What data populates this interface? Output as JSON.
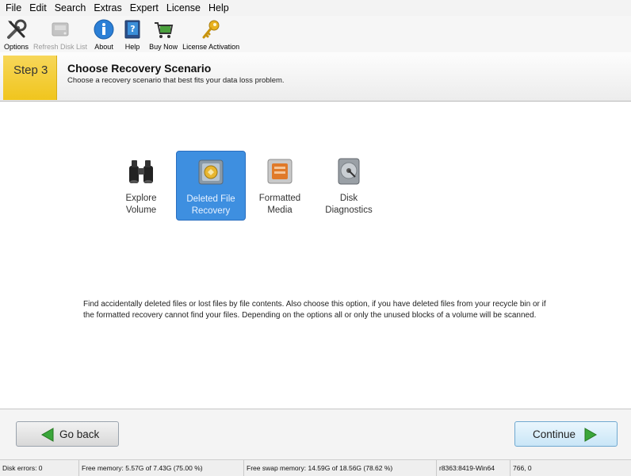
{
  "menu": [
    "File",
    "Edit",
    "Search",
    "Extras",
    "Expert",
    "License",
    "Help"
  ],
  "toolbar": {
    "options": "Options",
    "refresh": "Refresh Disk List",
    "about": "About",
    "help": "Help",
    "buy": "Buy Now",
    "license": "License Activation"
  },
  "step": {
    "badge": "Step 3",
    "title": "Choose Recovery Scenario",
    "subtitle": "Choose a recovery scenario that best fits your data loss problem."
  },
  "scenarios": [
    {
      "label": "Explore\nVolume",
      "icon": "binoculars-icon",
      "selected": false
    },
    {
      "label": "Deleted File\nRecovery",
      "icon": "recycle-bin-icon",
      "selected": true
    },
    {
      "label": "Formatted\nMedia",
      "icon": "formatted-disk-icon",
      "selected": false
    },
    {
      "label": "Disk\nDiagnostics",
      "icon": "disk-diagnostics-icon",
      "selected": false
    }
  ],
  "description": "Find accidentally deleted files or lost files by file contents. Also choose this option, if you have deleted files from your recycle bin or if the formatted recovery cannot find your files. Depending on the options all or only the unused blocks of a volume will be scanned.",
  "buttons": {
    "back": "Go back",
    "continue": "Continue"
  },
  "status": {
    "disk_errors": "Disk errors: 0",
    "free_memory": "Free memory: 5.57G of 7.43G (75.00 %)",
    "free_swap": "Free swap memory: 14.59G of 18.56G (78.62 %)",
    "build": "r8363:8419-Win64",
    "coords": "766, 0"
  },
  "colors": {
    "selected": "#3e8fe0",
    "badge": "#f0c51d",
    "arrow": "#3aa63a"
  }
}
